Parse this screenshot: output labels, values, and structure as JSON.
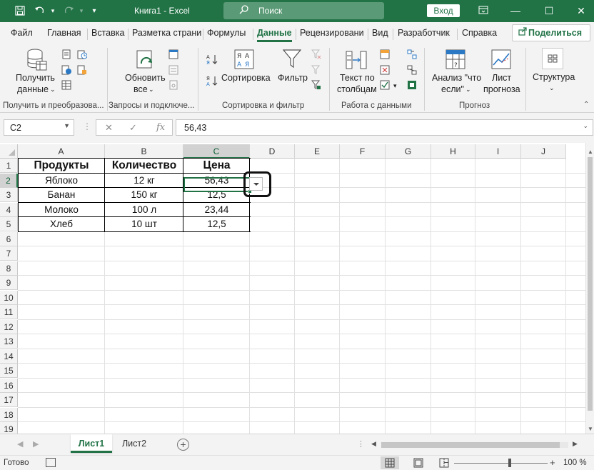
{
  "window": {
    "title": "Книга1 - Excel",
    "search_label": "Поиск",
    "signin_label": "Вход"
  },
  "tabs": [
    {
      "label": "Файл"
    },
    {
      "label": "Главная"
    },
    {
      "label": "Вставка"
    },
    {
      "label": "Разметка страни"
    },
    {
      "label": "Формулы"
    },
    {
      "label": "Данные",
      "active": true
    },
    {
      "label": "Рецензировани"
    },
    {
      "label": "Вид"
    },
    {
      "label": "Разработчик"
    },
    {
      "label": "Справка"
    }
  ],
  "share_label": "Поделиться",
  "ribbon": {
    "get_data_label_1": "Получить",
    "get_data_label_2": "данные",
    "refresh_label_1": "Обновить",
    "refresh_label_2": "все",
    "sort_label": "Сортировка",
    "filter_label": "Фильтр",
    "text_to_cols_1": "Текст по",
    "text_to_cols_2": "столбцам",
    "whatif_1": "Анализ \"что",
    "whatif_2": "если\"",
    "forecast_1": "Лист",
    "forecast_2": "прогноза",
    "outline_label": "Структура",
    "groups": {
      "get_transform": "Получить и преобразова...",
      "queries": "Запросы и подключе...",
      "sort_filter": "Сортировка и фильтр",
      "data_tools": "Работа с данными",
      "forecast": "Прогноз"
    }
  },
  "formula_bar": {
    "name_box": "C2",
    "fx": "fx",
    "value": "56,43"
  },
  "columns": [
    "A",
    "B",
    "C",
    "D",
    "E",
    "F",
    "G",
    "H",
    "I",
    "J"
  ],
  "rows": [
    "1",
    "2",
    "3",
    "4",
    "5",
    "6",
    "7",
    "8",
    "9",
    "10",
    "11",
    "12",
    "13",
    "14",
    "15",
    "16",
    "17",
    "18",
    "19"
  ],
  "table": {
    "headers": [
      "Продукты",
      "Количество",
      "Цена"
    ],
    "rows": [
      [
        "Яблоко",
        "12 кг",
        "56,43"
      ],
      [
        "Банан",
        "150 кг",
        "12,5"
      ],
      [
        "Молоко",
        "100 л",
        "23,44"
      ],
      [
        "Хлеб",
        "10 шт",
        "12,5"
      ]
    ]
  },
  "sheets": [
    {
      "label": "Лист1",
      "active": true
    },
    {
      "label": "Лист2"
    }
  ],
  "status": {
    "ready": "Готово",
    "zoom": "100 %"
  },
  "colors": {
    "accent": "#217346"
  }
}
